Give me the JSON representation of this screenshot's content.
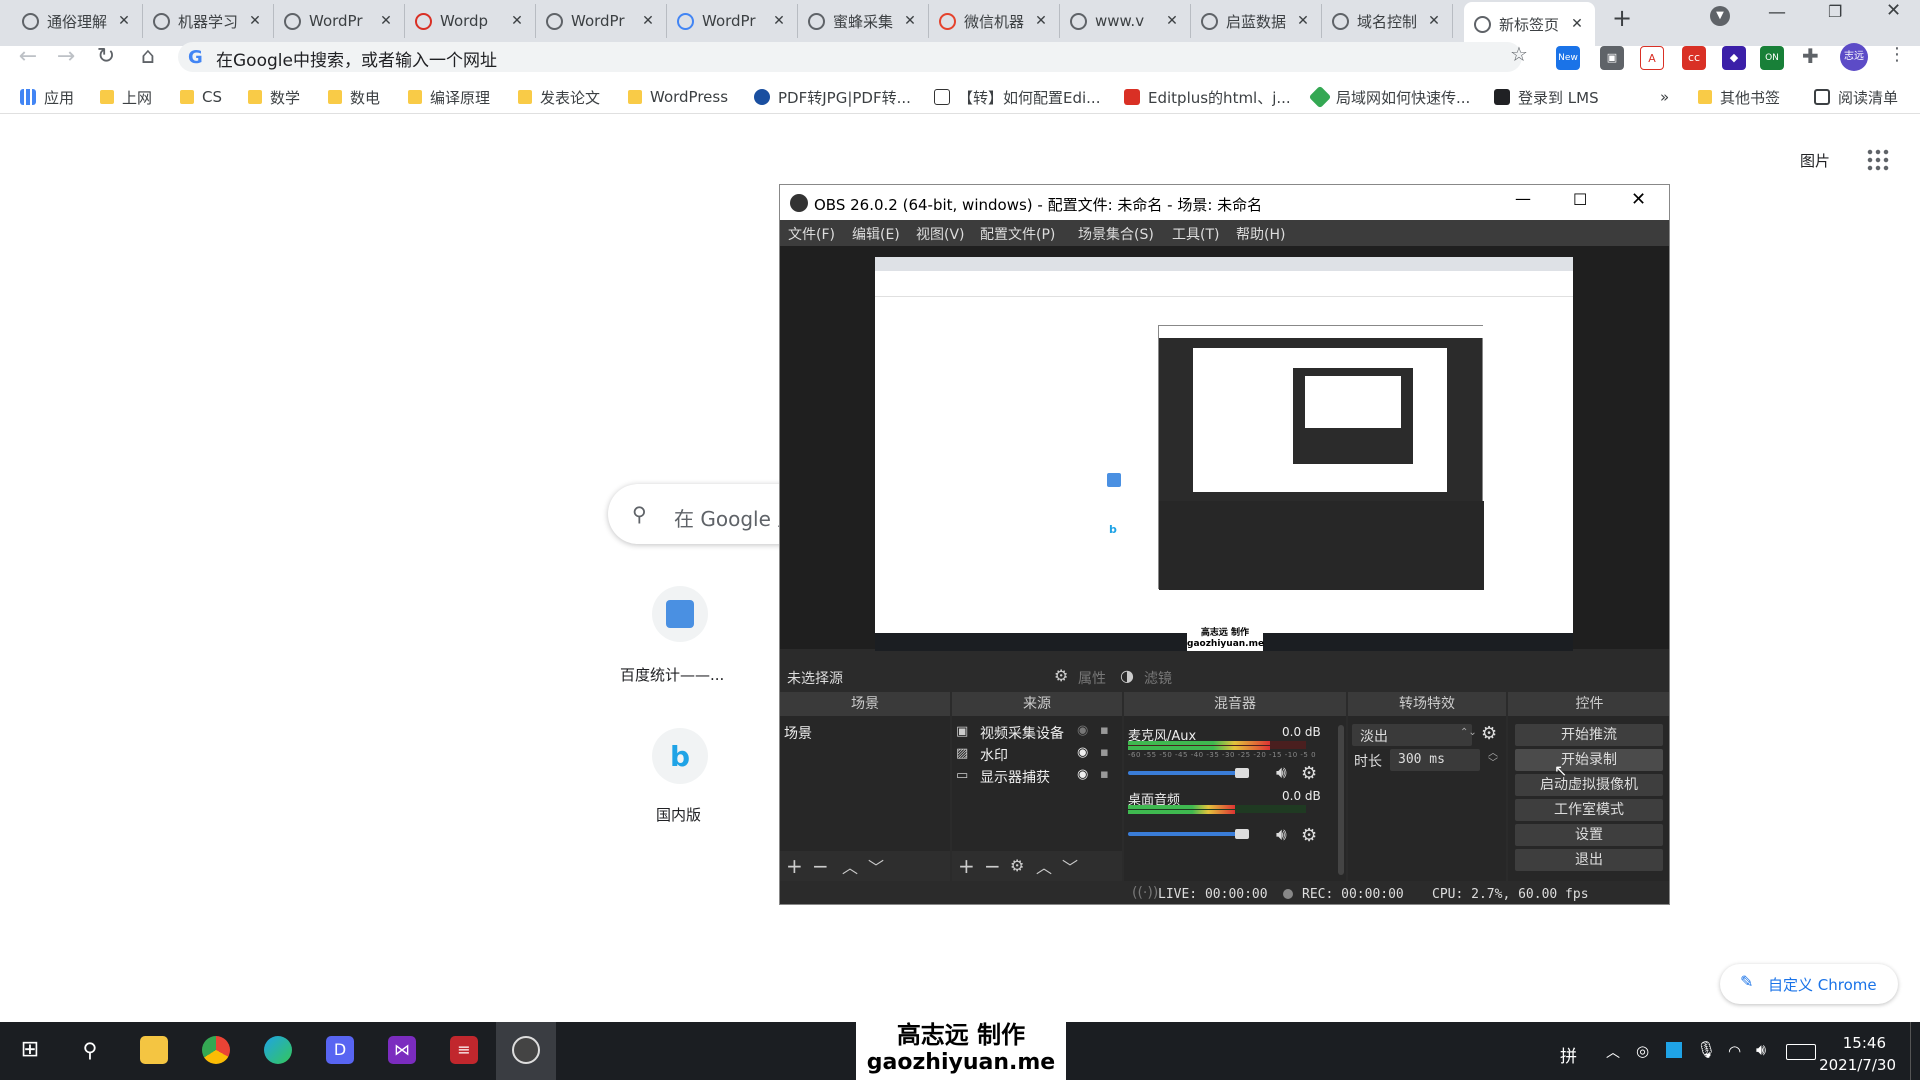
{
  "tabs": [
    {
      "label": "通俗理解"
    },
    {
      "label": "机器学习"
    },
    {
      "label": "WordPr"
    },
    {
      "label": "Wordp"
    },
    {
      "label": "WordPr"
    },
    {
      "label": "WordPr"
    },
    {
      "label": "蜜蜂采集"
    },
    {
      "label": "微信机器"
    },
    {
      "label": "www.v"
    },
    {
      "label": "启蓝数据"
    },
    {
      "label": "域名控制"
    },
    {
      "label": "新标签页"
    }
  ],
  "toolbar": {
    "omnibox_placeholder": "在Google中搜索，或者输入一个网址",
    "extensions": {
      "new_badge": "New",
      "on_badge": "ON",
      "profile": "志远"
    }
  },
  "bookmarks": [
    {
      "label": "应用"
    },
    {
      "label": "上网"
    },
    {
      "label": "CS"
    },
    {
      "label": "数学"
    },
    {
      "label": "数电"
    },
    {
      "label": "编译原理"
    },
    {
      "label": "发表论文"
    },
    {
      "label": "WordPress"
    },
    {
      "label": "PDF转JPG|PDF转..."
    },
    {
      "label": "【转】如何配置Edi..."
    },
    {
      "label": "Editplus的html、j..."
    },
    {
      "label": "局域网如何快速传..."
    },
    {
      "label": "登录到 LMS"
    },
    {
      "label": "»"
    },
    {
      "label": "其他书签"
    },
    {
      "label": "阅读清单"
    }
  ],
  "page": {
    "images_link": "图片",
    "search_placeholder": "在 Google 上",
    "shortcuts": [
      {
        "label": "百度统计——..."
      },
      {
        "label": "国内版"
      }
    ],
    "customize_label": "自定义 Chrome"
  },
  "obs": {
    "title": "OBS 26.0.2 (64-bit, windows) - 配置文件: 未命名 - 场景: 未命名",
    "menu": [
      "文件(F)",
      "编辑(E)",
      "视图(V)",
      "配置文件(P)",
      "场景集合(S)",
      "工具(T)",
      "帮助(H)"
    ],
    "no_source": "未选择源",
    "properties": "属性",
    "filters": "滤镜",
    "docks": {
      "scenes": "场景",
      "sources": "来源",
      "mixer": "混音器",
      "transitions": "转场特效",
      "controls": "控件"
    },
    "scene_items": [
      "场景"
    ],
    "source_items": [
      "视频采集设备",
      "水印",
      "显示器捕获"
    ],
    "mixer": [
      {
        "name": "麦克风/Aux",
        "db": "0.0 dB",
        "level": 0.8,
        "volume": 0.95
      },
      {
        "name": "桌面音频",
        "db": "0.0 dB",
        "level": 0.6,
        "volume": 0.95
      }
    ],
    "meter_ticks": [
      "-60",
      "-55",
      "-50",
      "-45",
      "-40",
      "-35",
      "-30",
      "-25",
      "-20",
      "-15",
      "-10",
      "-5",
      "0"
    ],
    "transition": {
      "type": "淡出",
      "duration_label": "时长",
      "duration": "300 ms"
    },
    "controls": [
      "开始推流",
      "开始录制",
      "启动虚拟摄像机",
      "工作室模式",
      "设置",
      "退出"
    ],
    "status": {
      "live": "LIVE: 00:00:00",
      "rec": "REC: 00:00:00",
      "cpu": "CPU: 2.7%, 60.00 fps"
    }
  },
  "watermark": {
    "line1": "高志远  制作",
    "line2": "gaozhiyuan.me"
  },
  "clock": {
    "time": "15:46",
    "date": "2021/7/30"
  },
  "ime": "拼"
}
